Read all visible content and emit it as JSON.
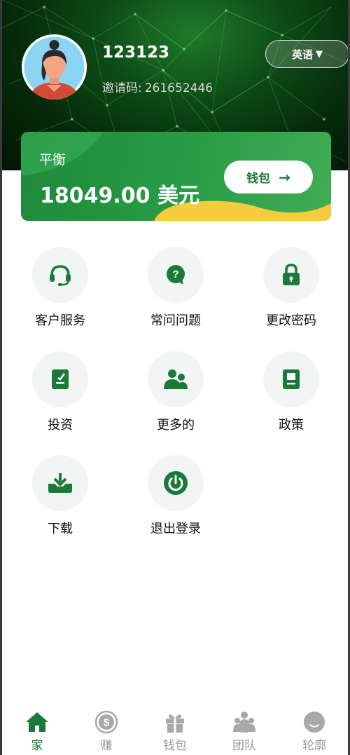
{
  "header": {
    "username": "123123",
    "invite_label": "邀请码:",
    "invite_code": "261652446",
    "language_button": "英语",
    "language_caret": "▼"
  },
  "balance": {
    "label": "平衡",
    "amount": "18049.00 美元",
    "wallet_button": "钱包",
    "wallet_arrow": "→"
  },
  "menu": [
    {
      "label": "客户服务",
      "icon": "headset-icon"
    },
    {
      "label": "常问问题",
      "icon": "question-bubble-icon"
    },
    {
      "label": "更改密码",
      "icon": "lock-icon"
    },
    {
      "label": "投资",
      "icon": "clipboard-edit-icon"
    },
    {
      "label": "更多的",
      "icon": "users-icon"
    },
    {
      "label": "政策",
      "icon": "document-icon"
    },
    {
      "label": "下载",
      "icon": "download-icon"
    },
    {
      "label": "退出登录",
      "icon": "power-icon"
    }
  ],
  "tabs": [
    {
      "label": "家",
      "icon": "home-icon",
      "active": true
    },
    {
      "label": "赚",
      "icon": "dollar-coin-icon",
      "active": false
    },
    {
      "label": "钱包",
      "icon": "gift-icon",
      "active": false
    },
    {
      "label": "团队",
      "icon": "team-icon",
      "active": false
    },
    {
      "label": "轮廓",
      "icon": "profile-icon",
      "active": false
    }
  ],
  "colors": {
    "primary": "#1b7a3a",
    "card_gradient_start": "#1d8a3b",
    "card_accent_yellow": "#f5cc3e",
    "icon_circle_bg": "#f2f5f4",
    "inactive_tab": "#9a9a9a"
  }
}
